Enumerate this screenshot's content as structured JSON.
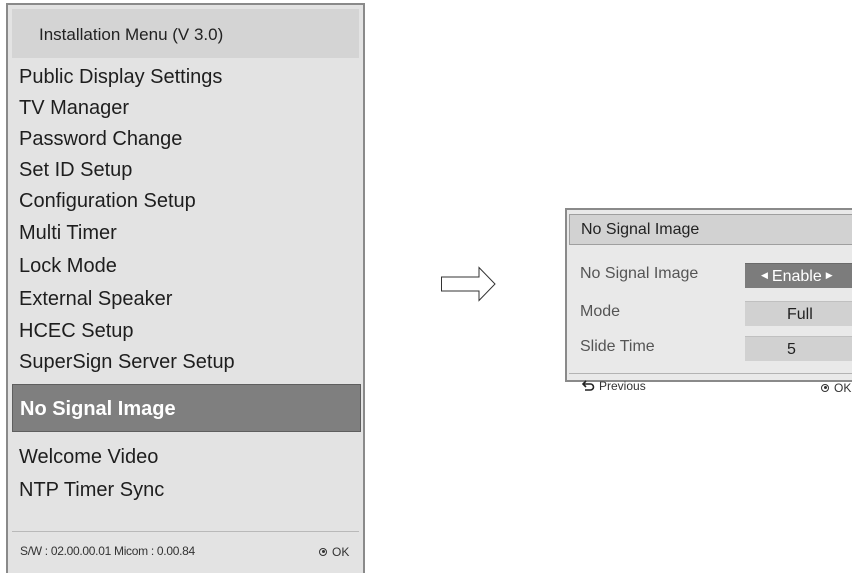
{
  "menu": {
    "title": "Installation Menu (V 3.0)",
    "items": [
      {
        "label": "Public Display Settings"
      },
      {
        "label": "TV Manager"
      },
      {
        "label": "Password Change"
      },
      {
        "label": "Set ID Setup"
      },
      {
        "label": "Configuration Setup"
      },
      {
        "label": "Multi Timer"
      },
      {
        "label": "Lock Mode"
      },
      {
        "label": "External Speaker"
      },
      {
        "label": "HCEC Setup"
      },
      {
        "label": "SuperSign Server Setup"
      },
      {
        "label": "No Signal Image",
        "selected": true
      },
      {
        "label": "Welcome Video"
      },
      {
        "label": "NTP Timer Sync"
      }
    ],
    "footer": {
      "version": "S/W : 02.00.00.01 Micom : 0.00.84",
      "ok_label": "OK"
    }
  },
  "arrow_icon": "right-outline-arrow-icon",
  "popup": {
    "title": "No Signal Image",
    "rows": [
      {
        "label": "No Signal Image",
        "value": "Enable",
        "active": true
      },
      {
        "label": "Mode",
        "value": "Full"
      },
      {
        "label": "Slide Time",
        "value": "5"
      }
    ],
    "footer": {
      "previous_label": "Previous",
      "ok_label": "OK"
    }
  },
  "colors": {
    "panel_bg": "#e3e3e3",
    "selection_bg": "#7f7f7f",
    "selection_text": "#ffffff",
    "border": "#8a8a8a"
  }
}
